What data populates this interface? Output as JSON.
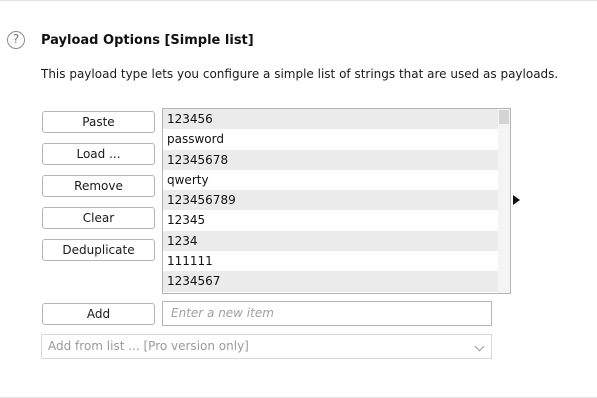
{
  "section": {
    "title": "Payload Options [Simple list]",
    "description": "This payload type lets you configure a simple list of strings that are used as payloads.",
    "help_icon": "?"
  },
  "buttons": {
    "paste": "Paste",
    "load": "Load ...",
    "remove": "Remove",
    "clear": "Clear",
    "deduplicate": "Deduplicate",
    "add": "Add"
  },
  "list": {
    "items": [
      "123456",
      "password",
      "12345678",
      "qwerty",
      "123456789",
      "12345",
      "1234",
      "111111",
      "1234567"
    ]
  },
  "add_input": {
    "placeholder": "Enter a new item"
  },
  "add_from_list": {
    "value": "Add from list ... [Pro version only]"
  }
}
